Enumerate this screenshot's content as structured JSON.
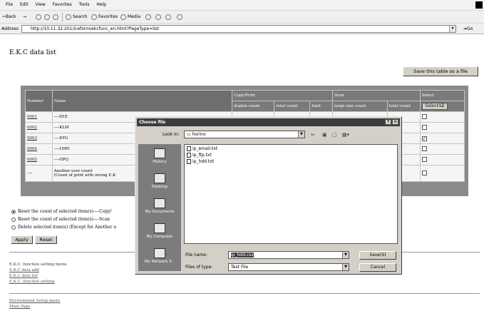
{
  "menu": [
    "File",
    "Edit",
    "View",
    "Favorites",
    "Tools",
    "Help"
  ],
  "toolbar": {
    "back": "⇦Back",
    "forward": "→",
    "search": "Search",
    "favorites": "Favorites",
    "media": "Media"
  },
  "address": {
    "label": "Address",
    "url": "http://10.11.32.201/iceform/ekcfunc_en.html?PageType=list",
    "go": "Go"
  },
  "page": {
    "title": "E.K.C data list",
    "save_button": "Save this table as a file"
  },
  "table": {
    "headers": {
      "number": "Number",
      "name": "Name",
      "copy_print": "Copy/Print",
      "scan": "Scan",
      "select": "Select",
      "duplex_count": "duplex count",
      "total_count": "total count",
      "limit": "limit",
      "large_size_count": "large size count",
      "scan_total_count": "total count",
      "select_all": "SelectAll"
    },
    "rows": [
      {
        "number": "0001",
        "name": "----XYZ",
        "checked": false
      },
      {
        "number": "0002",
        "name": "----KLM",
        "checked": false
      },
      {
        "number": "0003",
        "name": "----EFG",
        "checked": true
      },
      {
        "number": "0004",
        "name": "----LMN",
        "checked": false
      },
      {
        "number": "0005",
        "name": "----OPQ",
        "checked": false
      }
    ],
    "last_row": {
      "number": "----",
      "name_line1": "Another user count",
      "name_line2": "(Count of print with wrong E.K"
    }
  },
  "options": {
    "radio1": "Reset the count of selected item(s)----Copy/",
    "radio2": "Reset the count of selected item(s)----Scan",
    "radio3": "Delete selected item(s) (Except for Another u",
    "apply": "Apply",
    "reset": "Reset"
  },
  "footer": {
    "menu_title": "E.K.C. function setting menu",
    "link1": "E.K.C data add",
    "link2": "E.K.C data list",
    "link3": "E.K.C. function setting",
    "env_link": "Environment Setup menu",
    "main_link": "Main Page"
  },
  "dialog": {
    "title": "Choose file",
    "help": "?",
    "close": "×",
    "look_in_label": "Look in:",
    "look_in_value": "horino",
    "places": [
      "History",
      "Desktop",
      "My Documents",
      "My Computer",
      "My Network P..."
    ],
    "files": [
      "ip_email.txt",
      "ip_ftp.txt",
      "ip_hdd.txt"
    ],
    "file_name_label": "File name:",
    "file_name_value": "ip_hdd.csv",
    "file_type_label": "Files of type:",
    "file_type_value": "Text File",
    "save": "Save(S)",
    "cancel": "Cancel"
  }
}
